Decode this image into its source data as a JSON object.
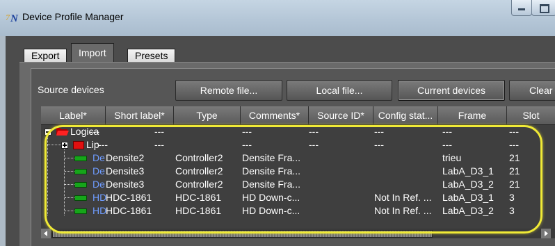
{
  "window": {
    "title": "Device Profile Manager",
    "app_icon": "N-logo-icon"
  },
  "tabs": [
    {
      "label": "Export",
      "active": false
    },
    {
      "label": "Import",
      "active": true
    },
    {
      "label": "Presets",
      "active": false
    }
  ],
  "source_section": {
    "label": "Source devices",
    "buttons": {
      "remote": "Remote file...",
      "local": "Local file...",
      "current": "Current devices",
      "clear": "Clear"
    }
  },
  "table": {
    "columns": [
      "Label*",
      "Short label*",
      "Type",
      "Comments*",
      "Source ID*",
      "Config stat...",
      "Frame",
      "Slot"
    ],
    "rows": [
      {
        "label": "Logica",
        "short": "---",
        "type": "---",
        "comments": "---",
        "source": "---",
        "config": "---",
        "frame": "---",
        "slot": "---"
      },
      {
        "label": "Lip",
        "short": "---",
        "type": "---",
        "comments": "---",
        "source": "---",
        "config": "---",
        "frame": "---",
        "slot": "---"
      },
      {
        "label": "De",
        "short": "Densite2",
        "type": "Controller2",
        "comments": "Densite Fra...",
        "source": "",
        "config": "",
        "frame": "trieu",
        "slot": "21"
      },
      {
        "label": "De",
        "short": "Densite3",
        "type": "Controller2",
        "comments": "Densite Fra...",
        "source": "",
        "config": "",
        "frame": "LabA_D3_1",
        "slot": "21"
      },
      {
        "label": "De",
        "short": "Densite3",
        "type": "Controller2",
        "comments": "Densite Fra...",
        "source": "",
        "config": "",
        "frame": "LabA_D3_2",
        "slot": "21"
      },
      {
        "label": "HD",
        "short": "HDC-1861",
        "type": "HDC-1861",
        "comments": "HD Down-c...",
        "source": "",
        "config": "Not In Ref. ...",
        "frame": "LabA_D3_1",
        "slot": "3"
      },
      {
        "label": "HD",
        "short": "HDC-1861",
        "type": "HDC-1861",
        "comments": "HD Down-c...",
        "source": "",
        "config": "Not In Ref. ...",
        "frame": "LabA_D3_2",
        "slot": "3"
      }
    ]
  },
  "colors": {
    "highlight": "#f0ea36",
    "label_link": "#6f9cff",
    "device_green": "#16a51a",
    "folder_red": "#e01010"
  }
}
